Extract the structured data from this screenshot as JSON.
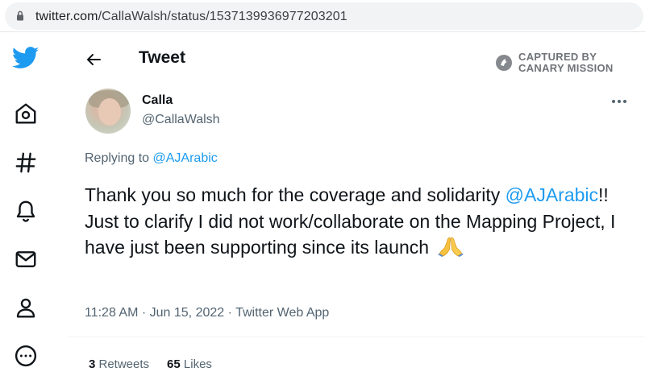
{
  "browser": {
    "url_domain": "twitter.com",
    "url_path": "/CallaWalsh/status/1537139936977203201"
  },
  "nav": {
    "items": [
      {
        "name": "twitter-logo-icon"
      },
      {
        "name": "home-icon"
      },
      {
        "name": "explore-hashtag-icon"
      },
      {
        "name": "notifications-bell-icon"
      },
      {
        "name": "messages-mail-icon"
      },
      {
        "name": "profile-person-icon"
      },
      {
        "name": "more-circle-icon"
      }
    ],
    "brand_color": "#1d9bf0"
  },
  "header": {
    "title": "Tweet",
    "watermark_line1": "CAPTURED BY",
    "watermark_line2": "CANARY MISSION"
  },
  "tweet": {
    "display_name": "Calla",
    "handle": "@CallaWalsh",
    "replying_prefix": "Replying to ",
    "replying_to": "@AJArabic",
    "text_part1": "Thank you so much for the coverage and solidarity ",
    "text_mention": "@AJArabic",
    "text_part2": "!! Just to clarify I did not work/collaborate on the Mapping Project, I have just been supporting since its launch",
    "emoji": "folded-hands",
    "timestamp": "11:28 AM · Jun 15, 2022 · Twitter Web App",
    "retweets_count": "3",
    "retweets_label": " Retweets",
    "likes_count": "65",
    "likes_label": " Likes"
  },
  "colors": {
    "link": "#1d9bf0",
    "secondary_text": "#536471",
    "primary_text": "#0f1419"
  }
}
